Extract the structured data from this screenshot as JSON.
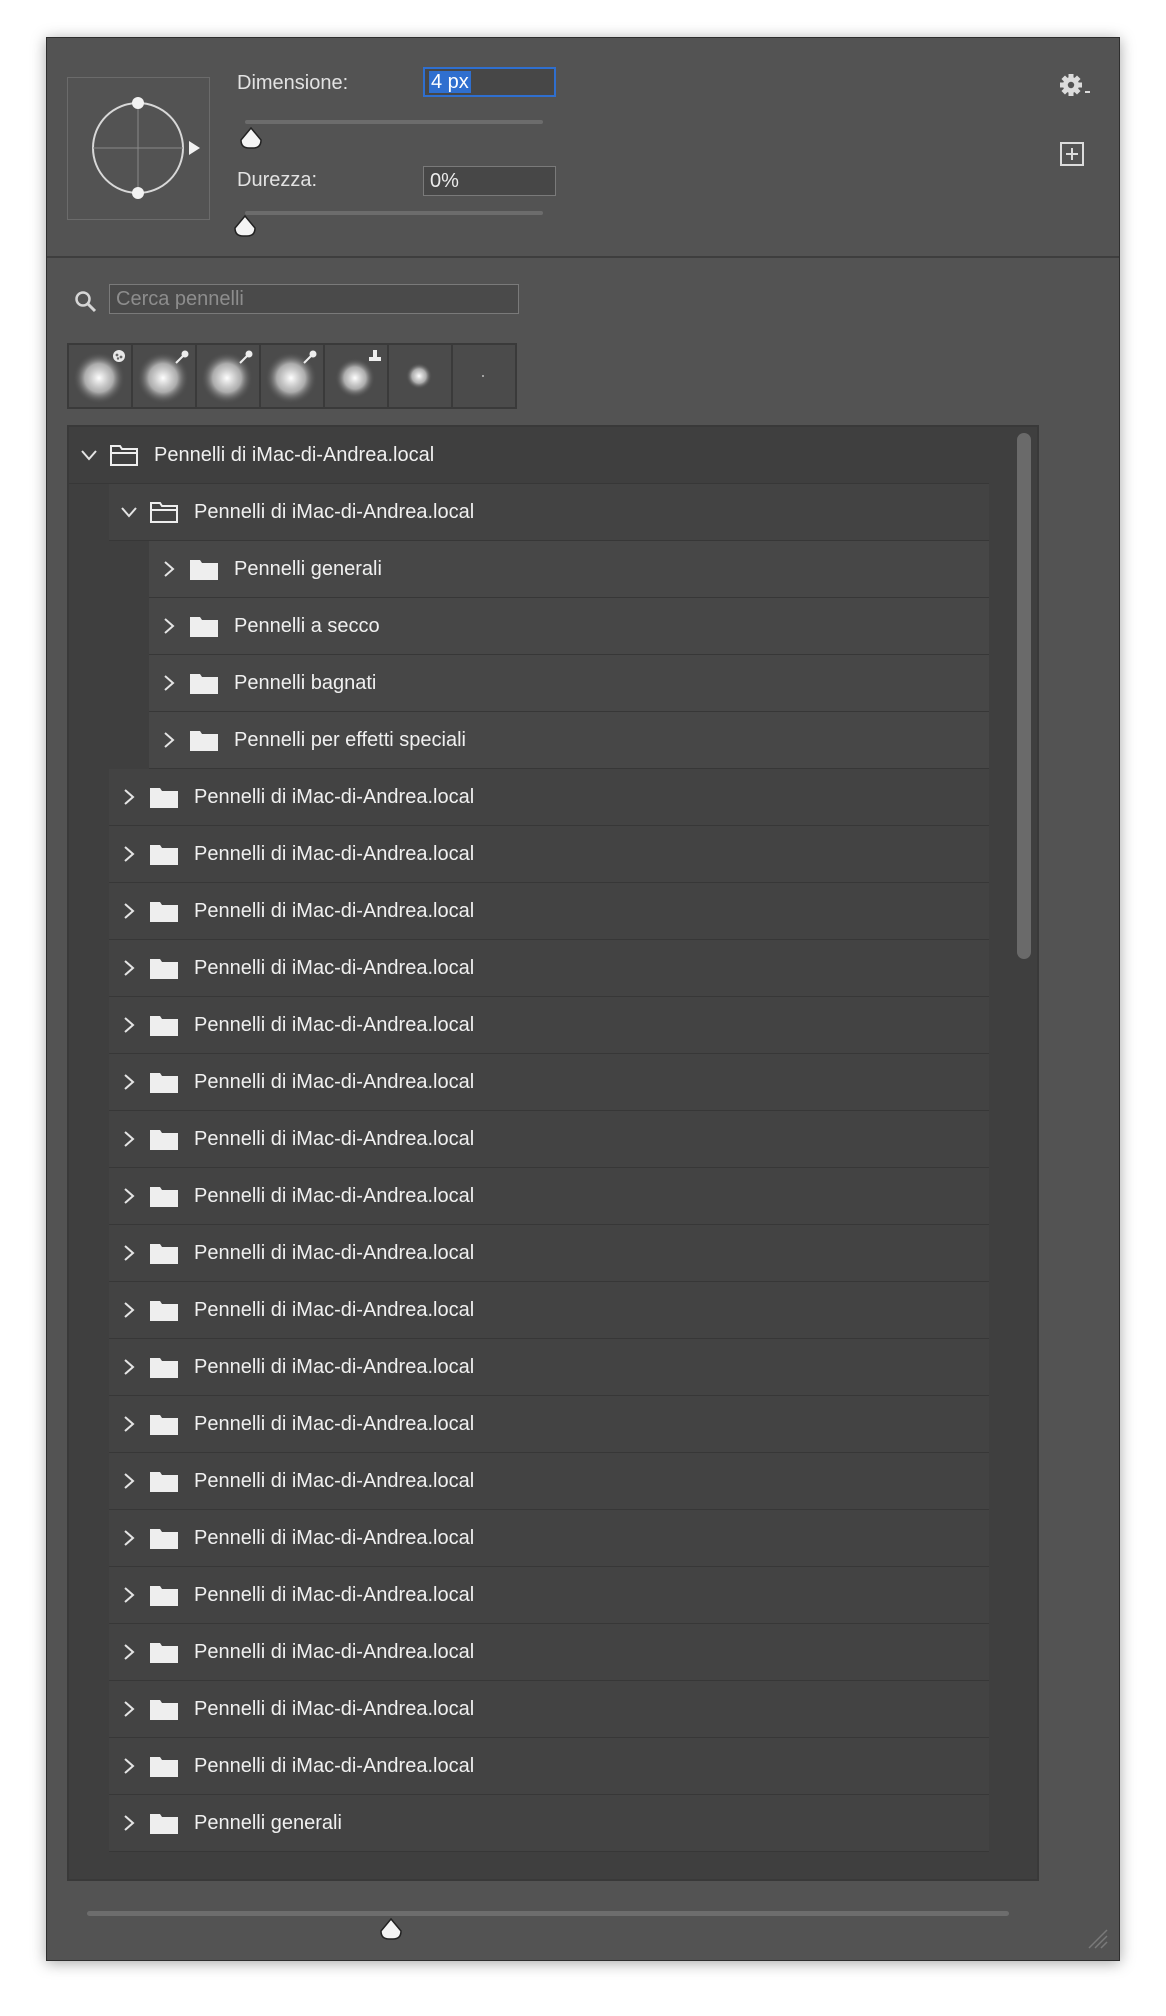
{
  "settings": {
    "size_label": "Dimensione:",
    "size_value": "4 px",
    "size_level": 0.02,
    "hardness_label": "Durezza:",
    "hardness_value": "0%",
    "hardness_level": 0.0
  },
  "search": {
    "placeholder": "Cerca pennelli"
  },
  "recent_brushes": [
    {
      "kind": "soft-round",
      "badge": "dots"
    },
    {
      "kind": "soft-round",
      "badge": "brush"
    },
    {
      "kind": "soft-round",
      "badge": "brush"
    },
    {
      "kind": "soft-round",
      "badge": "brush"
    },
    {
      "kind": "soft-round-small",
      "badge": "stamp"
    },
    {
      "kind": "soft-round-tiny",
      "badge": ""
    },
    {
      "kind": "dot",
      "badge": ""
    }
  ],
  "tree": [
    {
      "label": "Pennelli di iMac-di-Andrea.local",
      "level": 0,
      "expanded": true
    },
    {
      "label": "Pennelli di iMac-di-Andrea.local",
      "level": 1,
      "expanded": true
    },
    {
      "label": "Pennelli generali",
      "level": 2,
      "expanded": false
    },
    {
      "label": "Pennelli a secco",
      "level": 2,
      "expanded": false
    },
    {
      "label": "Pennelli bagnati",
      "level": 2,
      "expanded": false
    },
    {
      "label": "Pennelli per effetti speciali",
      "level": 2,
      "expanded": false
    },
    {
      "label": "Pennelli di iMac-di-Andrea.local",
      "level": 1,
      "expanded": false
    },
    {
      "label": "Pennelli di iMac-di-Andrea.local",
      "level": 1,
      "expanded": false
    },
    {
      "label": "Pennelli di iMac-di-Andrea.local",
      "level": 1,
      "expanded": false
    },
    {
      "label": "Pennelli di iMac-di-Andrea.local",
      "level": 1,
      "expanded": false
    },
    {
      "label": "Pennelli di iMac-di-Andrea.local",
      "level": 1,
      "expanded": false
    },
    {
      "label": "Pennelli di iMac-di-Andrea.local",
      "level": 1,
      "expanded": false
    },
    {
      "label": "Pennelli di iMac-di-Andrea.local",
      "level": 1,
      "expanded": false
    },
    {
      "label": "Pennelli di iMac-di-Andrea.local",
      "level": 1,
      "expanded": false
    },
    {
      "label": "Pennelli di iMac-di-Andrea.local",
      "level": 1,
      "expanded": false
    },
    {
      "label": "Pennelli di iMac-di-Andrea.local",
      "level": 1,
      "expanded": false
    },
    {
      "label": "Pennelli di iMac-di-Andrea.local",
      "level": 1,
      "expanded": false
    },
    {
      "label": "Pennelli di iMac-di-Andrea.local",
      "level": 1,
      "expanded": false
    },
    {
      "label": "Pennelli di iMac-di-Andrea.local",
      "level": 1,
      "expanded": false
    },
    {
      "label": "Pennelli di iMac-di-Andrea.local",
      "level": 1,
      "expanded": false
    },
    {
      "label": "Pennelli di iMac-di-Andrea.local",
      "level": 1,
      "expanded": false
    },
    {
      "label": "Pennelli di iMac-di-Andrea.local",
      "level": 1,
      "expanded": false
    },
    {
      "label": "Pennelli di iMac-di-Andrea.local",
      "level": 1,
      "expanded": false
    },
    {
      "label": "Pennelli di iMac-di-Andrea.local",
      "level": 1,
      "expanded": false
    },
    {
      "label": "Pennelli generali",
      "level": 1,
      "expanded": false
    }
  ],
  "preview_size_level": 0.33,
  "colors": {
    "panel": "#535353",
    "list": "#3f3f3f",
    "accent": "#2f6fcf",
    "text": "#f0f0f0"
  }
}
